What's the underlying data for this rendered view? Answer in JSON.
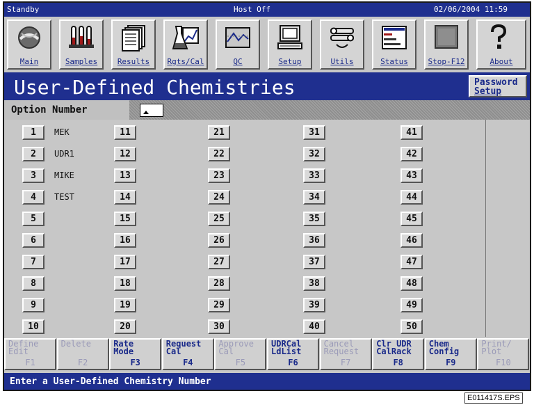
{
  "titlebar": {
    "mode": "Standby",
    "host": "Host Off",
    "datetime": "02/06/2004 11:59"
  },
  "toolbar": {
    "buttons": [
      {
        "label": "Main",
        "icon": "main-globe-icon"
      },
      {
        "label": "Samples",
        "icon": "samples-tubes-icon"
      },
      {
        "label": "Results",
        "icon": "results-pages-icon"
      },
      {
        "label": "Rgts/Cal",
        "icon": "reagents-flask-icon"
      },
      {
        "label": "QC",
        "icon": "qc-chart-icon"
      },
      {
        "label": "Setup",
        "icon": "setup-computer-icon"
      },
      {
        "label": "Utils",
        "icon": "utils-wrench-icon"
      },
      {
        "label": "Status",
        "icon": "status-bars-icon"
      },
      {
        "label": "Stop-F12",
        "icon": "stop-square-icon"
      },
      {
        "label": "About",
        "icon": "about-question-icon"
      }
    ]
  },
  "header": {
    "title": "User-Defined Chemistries",
    "password_line1": "Password",
    "password_line2": "Setup"
  },
  "option": {
    "label": "Option Number"
  },
  "chemistries": {
    "col1": [
      {
        "num": "1",
        "name": "MEK"
      },
      {
        "num": "2",
        "name": "UDR1"
      },
      {
        "num": "3",
        "name": "MIKE"
      },
      {
        "num": "4",
        "name": "TEST"
      },
      {
        "num": "5",
        "name": ""
      },
      {
        "num": "6",
        "name": ""
      },
      {
        "num": "7",
        "name": ""
      },
      {
        "num": "8",
        "name": ""
      },
      {
        "num": "9",
        "name": ""
      },
      {
        "num": "10",
        "name": ""
      }
    ],
    "col2": [
      "11",
      "12",
      "13",
      "14",
      "15",
      "16",
      "17",
      "18",
      "19",
      "20"
    ],
    "col3": [
      "21",
      "22",
      "23",
      "24",
      "25",
      "26",
      "27",
      "28",
      "29",
      "30"
    ],
    "col4": [
      "31",
      "32",
      "33",
      "34",
      "35",
      "36",
      "37",
      "38",
      "39",
      "40"
    ],
    "col5": [
      "41",
      "42",
      "43",
      "44",
      "45",
      "46",
      "47",
      "48",
      "49",
      "50"
    ]
  },
  "fkeys": [
    {
      "text": "Define\nEdit",
      "key": "F1",
      "enabled": false
    },
    {
      "text": "Delete",
      "key": "F2",
      "enabled": false
    },
    {
      "text": "Rate\nMode",
      "key": "F3",
      "enabled": true
    },
    {
      "text": "Request\nCal",
      "key": "F4",
      "enabled": true
    },
    {
      "text": "Approve\nCal",
      "key": "F5",
      "enabled": false
    },
    {
      "text": "UDRCal\nLdList",
      "key": "F6",
      "enabled": true
    },
    {
      "text": "Cancel\nRequest",
      "key": "F7",
      "enabled": false
    },
    {
      "text": "Clr UDR\nCalRack",
      "key": "F8",
      "enabled": true
    },
    {
      "text": "Chem\nConfig",
      "key": "F9",
      "enabled": true
    },
    {
      "text": "Print/\nPlot",
      "key": "F10",
      "enabled": false
    }
  ],
  "status": {
    "message": "Enter a User-Defined Chemistry Number"
  },
  "figure_ref": "E011417S.EPS",
  "colors": {
    "bar_blue": "#1f2f8f",
    "panel_gray": "#c7c7c7",
    "label_blue": "#1a2a8a"
  }
}
